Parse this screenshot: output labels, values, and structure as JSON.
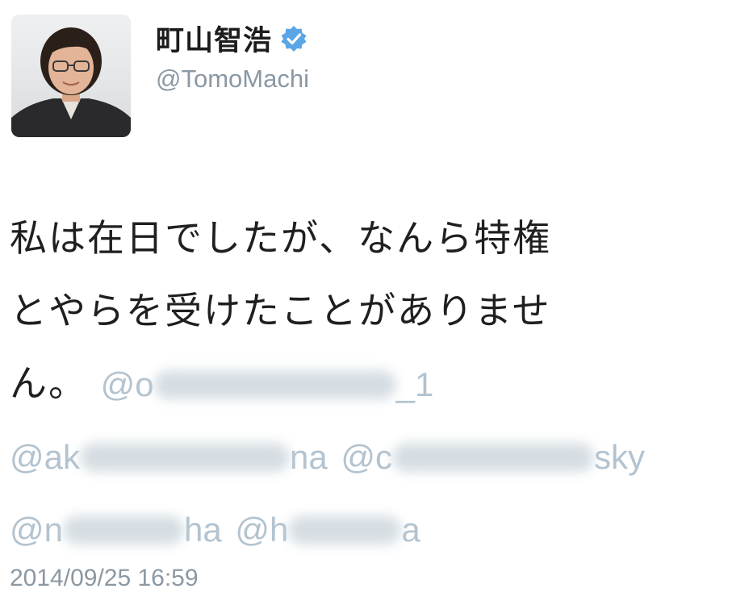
{
  "tweet": {
    "display_name": "町山智浩",
    "handle": "@TomoMachi",
    "verified": true,
    "text_line_1": "私は在日でしたが、なんら特権",
    "text_line_2": "とやらを受けたことがありませ",
    "text_line_3_start": "ん。",
    "mentions": {
      "m1_prefix": "@o",
      "m1_suffix": "_1",
      "m2_prefix": "@ak",
      "m2_suffix": "na",
      "m3_prefix": "@c",
      "m3_suffix": "sky",
      "m4_prefix": "@n",
      "m4_suffix": "ha",
      "m5_prefix": "@h",
      "m5_suffix": "a"
    },
    "timestamp": "2014/09/25 16:59"
  },
  "icons": {
    "verified": "verified-badge-icon",
    "avatar": "profile-photo"
  },
  "colors": {
    "verified_blue": "#5aa5e6",
    "handle_gray": "#8b98a3",
    "mention_faded": "#b3c3cf"
  }
}
